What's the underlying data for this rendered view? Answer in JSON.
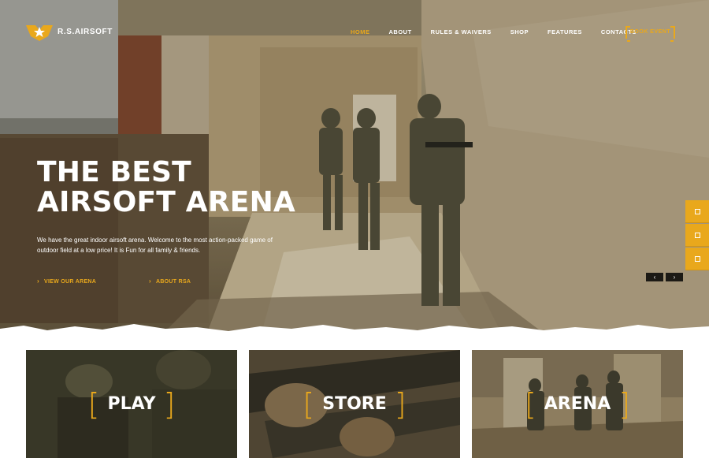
{
  "brand": {
    "name": "R.S.AIRSOFT",
    "logo_icon": "star-wings-emblem"
  },
  "nav": {
    "items": [
      {
        "label": "HOME",
        "active": true
      },
      {
        "label": "ABOUT",
        "active": false
      },
      {
        "label": "RULES & WAIVERS",
        "active": false
      },
      {
        "label": "SHOP",
        "active": false
      },
      {
        "label": "FEATURES",
        "active": false
      },
      {
        "label": "CONTACTS",
        "active": false
      }
    ],
    "cta_label": "BOOK EVENT"
  },
  "hero": {
    "title_line1": "THE BEST",
    "title_line2": "AIRSOFT ARENA",
    "description": "We have the great indoor airsoft arena. Welcome to the most action-packed game of outdoor field at a low price! It is Fun for all family & friends.",
    "link1": "VIEW OUR ARENA",
    "link2": "ABOUT RSA",
    "prev_icon": "chevron-left-icon",
    "next_icon": "chevron-right-icon"
  },
  "side_tabs": [
    "tab-icon-1",
    "tab-icon-2",
    "tab-icon-3"
  ],
  "cards": [
    {
      "label": "PLAY",
      "bracket_left": "[",
      "bracket_right": "]"
    },
    {
      "label": "STORE",
      "bracket_left": "[",
      "bracket_right": "]"
    },
    {
      "label": "ARENA",
      "bracket_left": "[",
      "bracket_right": "]"
    }
  ],
  "colors": {
    "accent": "#e9a81c",
    "text_light": "#ffffff",
    "slider_arrow_bg": "#1c1a15"
  }
}
